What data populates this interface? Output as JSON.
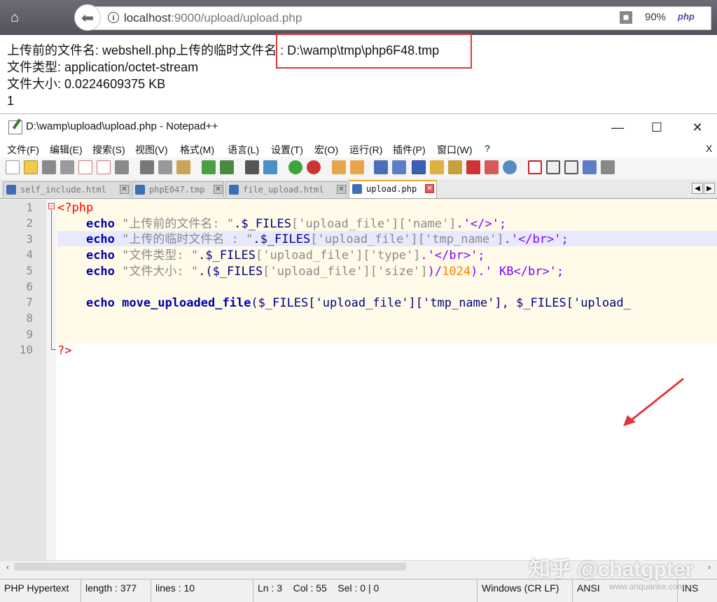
{
  "browser": {
    "url_host": "localhost",
    "url_rest": ":9000/upload/upload.php",
    "zoom": "90%",
    "extension_label": "php"
  },
  "page_output": {
    "line1": "上传前的文件名: webshell.php上传的临时文件名 : D:\\wamp\\tmp\\php6F48.tmp",
    "line2": "文件类型: application/octet-stream",
    "line3": "文件大小: 0.0224609375 KB",
    "line4": "1"
  },
  "notepad": {
    "title": "D:\\wamp\\upload\\upload.php - Notepad++",
    "window_buttons": {
      "minimize": "—",
      "maximize": "☐",
      "close": "✕"
    },
    "menu": [
      "文件(F)",
      "编辑(E)",
      "搜索(S)",
      "视图(V)",
      "格式(M)",
      "语言(L)",
      "设置(T)",
      "宏(O)",
      "运行(R)",
      "插件(P)",
      "窗口(W)",
      "?"
    ],
    "menu_close": "X",
    "tabs": [
      {
        "label": "self_include.html",
        "active": false
      },
      {
        "label": "phpE047.tmp",
        "active": false
      },
      {
        "label": "file_upload.html",
        "active": false
      },
      {
        "label": "upload.php",
        "active": true
      }
    ],
    "line_numbers": [
      "1",
      "2",
      "3",
      "4",
      "5",
      "6",
      "7",
      "8",
      "9",
      "10"
    ],
    "current_line": 3,
    "status": {
      "language": "PHP Hypertext",
      "length": "length : 377",
      "lines": "lines : 10",
      "position": "Ln : 3    Col : 55    Sel : 0 | 0",
      "eol": "Windows (CR LF)",
      "encoding": "ANSI",
      "mode": "INS"
    }
  },
  "code": {
    "l1_open": "<?php",
    "echo": "echo",
    "l2_str": "\"上传前的文件名: \"",
    "l2_rest_a": ".$_FILES",
    "l2_idx1": "['upload_file']",
    "l2_idx2": "['name']",
    "l2_end": ".'</>';",
    "l3_str": "\"上传的临时文件名 : \"",
    "l3_idx2": "['tmp_name']",
    "l3_end": ".'</br>';",
    "l4_str": "\"文件类型: \"",
    "l4_idx2": "['type']",
    "l4_end": ".'</br>';",
    "l5_str": "\"文件大小: \"",
    "l5_a": ".($_FILES",
    "l5_idx2": "['size']",
    "l5_div": ")/",
    "l5_num": "1024",
    "l5_end": ").' KB</br>';",
    "l7_fn": "move_uploaded_file",
    "l7_rest": "($_FILES['upload_file']['tmp_name'], $_FILES['upload_",
    "l10_close": "?>"
  },
  "watermark": "知乎 @chatgpter",
  "watermark_small": "www.anquanke.com",
  "colors": {
    "highlight_box": "#e0373d",
    "arrow": "#e0373d",
    "active_tab_accent": "#f9a72a"
  }
}
